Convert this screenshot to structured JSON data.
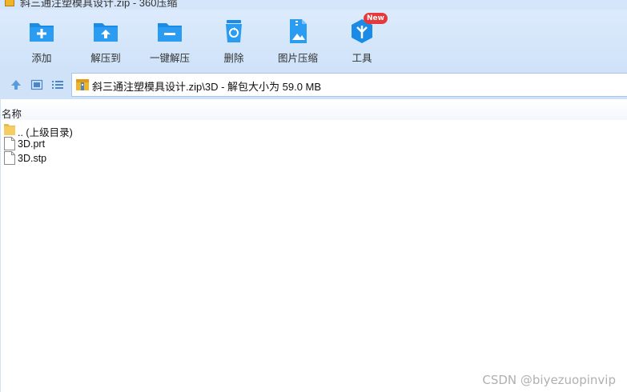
{
  "window": {
    "title": "斜三通注塑模具设计.zip - 360压缩"
  },
  "toolbar": {
    "items": [
      {
        "label": "添加",
        "icon": "folder-add-icon"
      },
      {
        "label": "解压到",
        "icon": "folder-extract-icon"
      },
      {
        "label": "一键解压",
        "icon": "folder-one-click-extract-icon"
      },
      {
        "label": "删除",
        "icon": "recycle-bin-icon"
      },
      {
        "label": "图片压缩",
        "icon": "image-compress-icon"
      },
      {
        "label": "工具",
        "icon": "tools-cube-icon",
        "badge": "New"
      }
    ]
  },
  "nav": {
    "up_icon": "arrow-up-icon",
    "thumbnail_icon": "thumbnail-view-icon",
    "list_icon": "list-view-icon"
  },
  "address": {
    "path": "斜三通注塑模具设计.zip\\3D - 解包大小为 59.0 MB"
  },
  "file_list": {
    "column_name": "名称",
    "rows": [
      {
        "name": ".. (上级目录)",
        "type": "folder"
      },
      {
        "name": "3D.prt",
        "type": "file"
      },
      {
        "name": "3D.stp",
        "type": "file"
      }
    ]
  },
  "watermark": "CSDN @biyezuopinvip",
  "colors": {
    "toolbar_bg": "#d6e6fa",
    "icon_blue": "#1a8be6",
    "badge_red": "#e8393a",
    "folder_yellow": "#f5cd62"
  }
}
